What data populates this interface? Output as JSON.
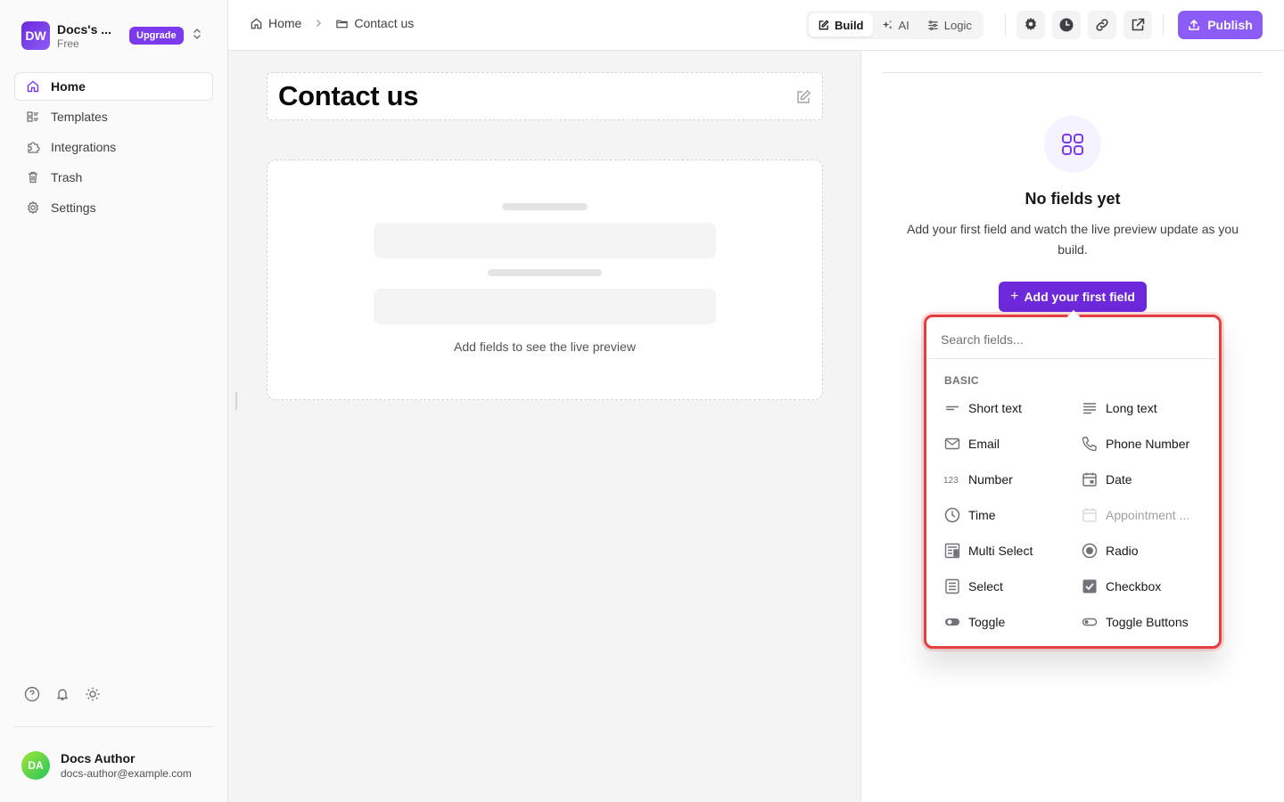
{
  "workspace": {
    "initials": "DW",
    "name": "Docs's ...",
    "plan": "Free",
    "upgrade_label": "Upgrade"
  },
  "sidebar": {
    "items": [
      {
        "label": "Home",
        "icon": "home-icon",
        "active": true
      },
      {
        "label": "Templates",
        "icon": "templates-icon"
      },
      {
        "label": "Integrations",
        "icon": "puzzle-icon"
      },
      {
        "label": "Trash",
        "icon": "trash-icon"
      },
      {
        "label": "Settings",
        "icon": "gear-icon"
      }
    ]
  },
  "user": {
    "initials": "DA",
    "name": "Docs Author",
    "email": "docs-author@example.com"
  },
  "header": {
    "breadcrumb": [
      {
        "label": "Home"
      },
      {
        "label": "Contact us"
      }
    ],
    "modes": [
      {
        "label": "Build",
        "active": true
      },
      {
        "label": "AI"
      },
      {
        "label": "Logic"
      }
    ],
    "publish_label": "Publish"
  },
  "form": {
    "title": "Contact us",
    "preview_hint": "Add fields to see the live preview"
  },
  "panel": {
    "empty_title": "No fields yet",
    "empty_desc": "Add your first field and watch the live preview update as you build.",
    "add_button_label": "Add your first field"
  },
  "dropdown": {
    "search_placeholder": "Search fields...",
    "group_label": "BASIC",
    "fields": [
      {
        "label": "Short text",
        "icon": "short-text-icon"
      },
      {
        "label": "Long text",
        "icon": "long-text-icon"
      },
      {
        "label": "Email",
        "icon": "email-icon"
      },
      {
        "label": "Phone Number",
        "icon": "phone-icon"
      },
      {
        "label": "Number",
        "icon": "number-icon"
      },
      {
        "label": "Date",
        "icon": "calendar-icon"
      },
      {
        "label": "Time",
        "icon": "clock-icon"
      },
      {
        "label": "Appointment ...",
        "icon": "appointment-icon",
        "disabled": true
      },
      {
        "label": "Multi Select",
        "icon": "multi-select-icon"
      },
      {
        "label": "Radio",
        "icon": "radio-icon"
      },
      {
        "label": "Select",
        "icon": "select-icon"
      },
      {
        "label": "Checkbox",
        "icon": "checkbox-icon"
      },
      {
        "label": "Toggle",
        "icon": "toggle-icon"
      },
      {
        "label": "Toggle Buttons",
        "icon": "toggle-buttons-icon"
      }
    ]
  },
  "colors": {
    "accent": "#7c3aed",
    "highlight": "#e53e3e"
  }
}
